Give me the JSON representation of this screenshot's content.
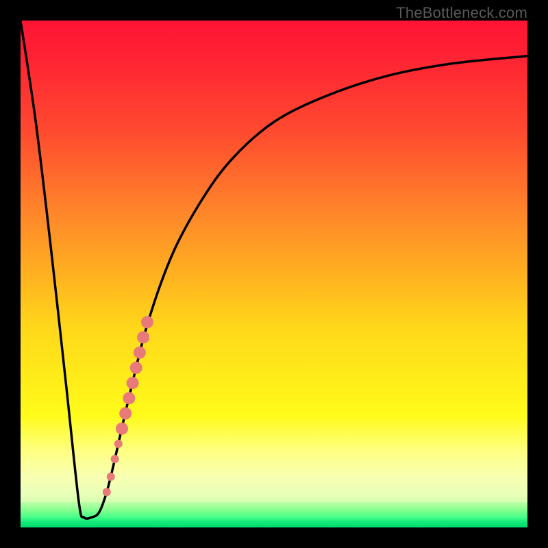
{
  "attribution": "TheBottleneck.com",
  "chart_data": {
    "type": "line",
    "title": "",
    "xlabel": "",
    "ylabel": "",
    "xlim": [
      0,
      1
    ],
    "ylim": [
      0,
      1
    ],
    "background_gradient": {
      "top_color": "#ff1434",
      "mid_colors": [
        "#ffb020",
        "#ffff3a",
        "#fbffc0"
      ],
      "bottom_color": "#00d86e"
    },
    "series": [
      {
        "name": "bottleneck-curve",
        "color": "#000000",
        "x": [
          0.0,
          0.03,
          0.06,
          0.09,
          0.115,
          0.125,
          0.14,
          0.155,
          0.17,
          0.185,
          0.21,
          0.25,
          0.3,
          0.36,
          0.42,
          0.5,
          0.6,
          0.72,
          0.85,
          1.0
        ],
        "y": [
          1.0,
          0.8,
          0.55,
          0.28,
          0.05,
          0.02,
          0.02,
          0.03,
          0.07,
          0.13,
          0.24,
          0.4,
          0.54,
          0.65,
          0.73,
          0.8,
          0.85,
          0.89,
          0.915,
          0.93
        ]
      }
    ],
    "cluster_points": {
      "name": "data-points",
      "color": "#e97a7a",
      "radius_small": 6,
      "radius_large": 9,
      "points": [
        {
          "x": 0.17,
          "y": 0.07,
          "r": "small"
        },
        {
          "x": 0.178,
          "y": 0.1,
          "r": "small"
        },
        {
          "x": 0.186,
          "y": 0.135,
          "r": "small"
        },
        {
          "x": 0.193,
          "y": 0.165,
          "r": "small"
        },
        {
          "x": 0.2,
          "y": 0.195,
          "r": "large"
        },
        {
          "x": 0.207,
          "y": 0.225,
          "r": "large"
        },
        {
          "x": 0.214,
          "y": 0.255,
          "r": "large"
        },
        {
          "x": 0.221,
          "y": 0.285,
          "r": "large"
        },
        {
          "x": 0.228,
          "y": 0.315,
          "r": "large"
        },
        {
          "x": 0.235,
          "y": 0.345,
          "r": "large"
        },
        {
          "x": 0.242,
          "y": 0.375,
          "r": "large"
        },
        {
          "x": 0.25,
          "y": 0.405,
          "r": "large"
        }
      ]
    }
  }
}
